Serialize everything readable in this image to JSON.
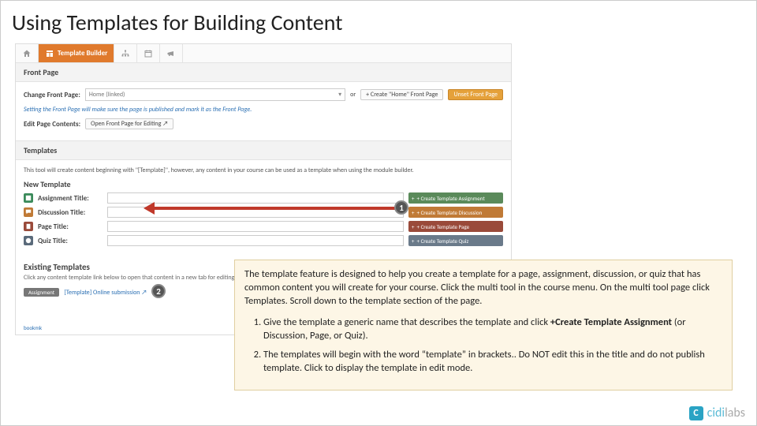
{
  "slide": {
    "title": "Using Templates for Building Content"
  },
  "nav": {
    "home_icon": "home",
    "active_label": "Template Builder"
  },
  "front_page": {
    "header": "Front Page",
    "change_label": "Change Front Page:",
    "select_value": "Home (linked)",
    "or_text": "or",
    "create_home_btn": "+ Create \"Home\" Front Page",
    "unset_btn": "Unset Front Page",
    "note": "Setting the Front Page will make sure the page is published and mark it as the Front Page.",
    "edit_label": "Edit Page Contents:",
    "edit_btn": "Open Front Page for Editing ↗"
  },
  "templates": {
    "header": "Templates",
    "desc": "This tool will create content beginning with \"[Template]\", however, any content in your course can be used as a template when using the module builder.",
    "new_header": "New Template",
    "rows": [
      {
        "label": "Assignment Title:",
        "btn": "+ Create Template Assignment"
      },
      {
        "label": "Discussion Title:",
        "btn": "+ Create Template Discussion"
      },
      {
        "label": "Page Title:",
        "btn": "+ Create Template Page"
      },
      {
        "label": "Quiz Title:",
        "btn": "+ Create Template Quiz"
      }
    ],
    "existing_header": "Existing Templates",
    "existing_sub": "Click any content template link below to open that content in a new tab for editing.",
    "pill": "Assignment",
    "ex_link": "[Template] Online submission ↗",
    "bookmark": "bookmk"
  },
  "markers": {
    "one": "1",
    "two": "2"
  },
  "callout": {
    "para": "The template feature is designed to help you create a template for a page, assignment, discussion, or quiz that has common content you will create for your course. Click the multi tool in the course menu. On the multi tool page click Templates. Scroll down to the template section of the page.",
    "item1_pre": "Give the template a generic name that describes the template and click ",
    "item1_bold": "+Create Template Assignment",
    "item1_post": " (or Discussion, Page, or Quiz).",
    "item2": "The templates will begin with the word “template” in brackets.. Do NOT edit this in the title and do not publish template. Click to display the template in edit mode."
  },
  "logo": {
    "mark": "C",
    "name": "cidi",
    "suffix": "labs"
  }
}
